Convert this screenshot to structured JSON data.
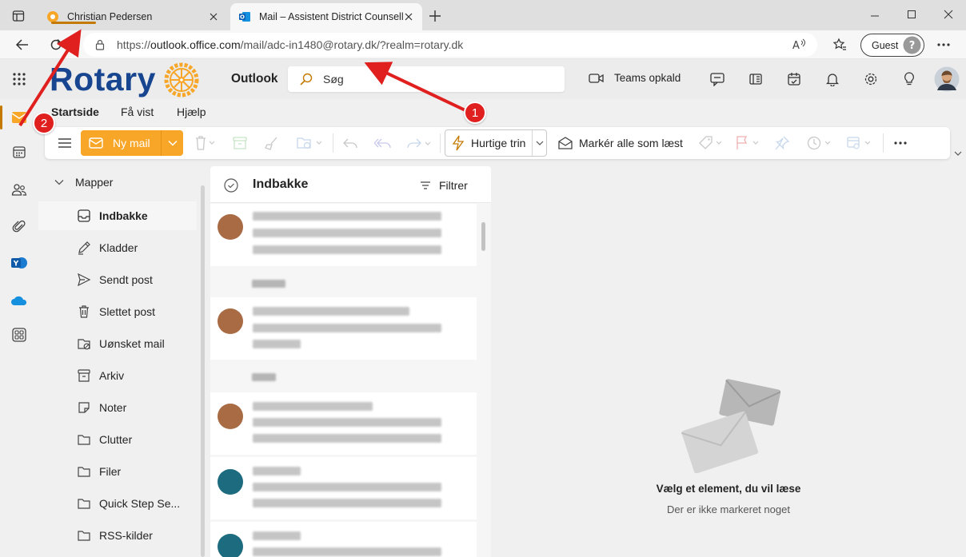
{
  "browser": {
    "tabs": [
      {
        "title": "Christian Pedersen"
      },
      {
        "title": "Mail – Assistent District Counsello"
      }
    ],
    "url": {
      "prefix": "https://",
      "host": "outlook.office.com",
      "path": "/mail/adc-in1480@rotary.dk/?realm=rotary.dk"
    },
    "guest_label": "Guest"
  },
  "header": {
    "logo_text": "Rotary",
    "app_name": "Outlook",
    "search_placeholder": "Søg",
    "teams_label": "Teams opkald"
  },
  "ribbon": {
    "tabs": [
      "Startside",
      "Få vist",
      "Hjælp"
    ],
    "active_tab": "Startside",
    "new_mail_label": "Ny mail",
    "quick_steps_label": "Hurtige trin",
    "mark_all_read_label": "Markér alle som læst"
  },
  "folders": {
    "header": "Mapper",
    "items": [
      {
        "label": "Indbakke",
        "icon": "inbox-icon",
        "selected": true
      },
      {
        "label": "Kladder",
        "icon": "drafts-icon"
      },
      {
        "label": "Sendt post",
        "icon": "send-icon"
      },
      {
        "label": "Slettet post",
        "icon": "trash-icon"
      },
      {
        "label": "Uønsket mail",
        "icon": "junk-icon"
      },
      {
        "label": "Arkiv",
        "icon": "archive-icon"
      },
      {
        "label": "Noter",
        "icon": "note-icon"
      },
      {
        "label": "Clutter",
        "icon": "folder-icon"
      },
      {
        "label": "Filer",
        "icon": "folder-icon"
      },
      {
        "label": "Quick Step Se...",
        "icon": "folder-icon"
      },
      {
        "label": "RSS-kilder",
        "icon": "folder-icon"
      }
    ]
  },
  "message_list": {
    "title": "Indbakke",
    "filter_label": "Filtrer"
  },
  "reading_pane": {
    "empty_title": "Vælg et element, du vil læse",
    "empty_subtitle": "Der er ikke markeret noget"
  },
  "annotations": {
    "badge_1": "1",
    "badge_2": "2"
  },
  "colors": {
    "accent": "#f7a628",
    "rotary_blue": "#17458f",
    "annotation_red": "#e0201e"
  }
}
